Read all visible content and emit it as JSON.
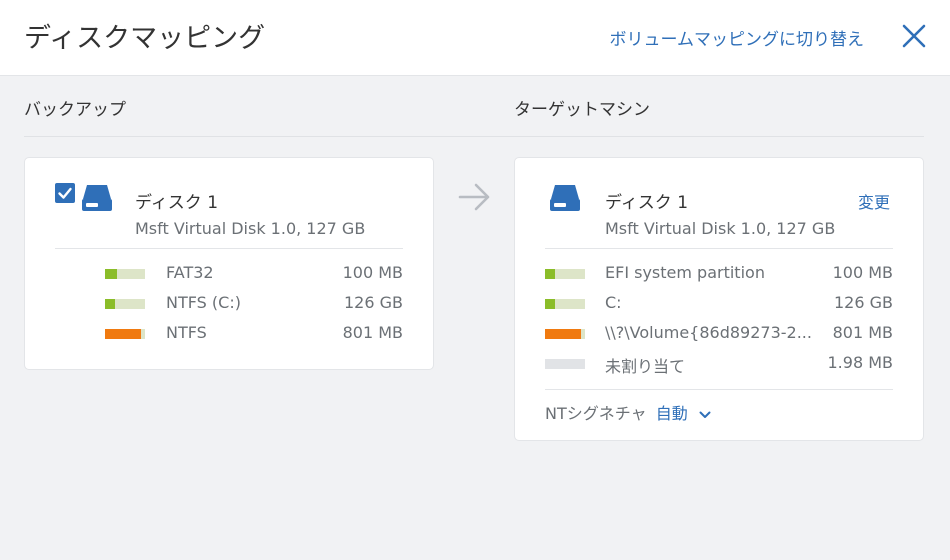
{
  "header": {
    "title": "ディスクマッピング",
    "switch_link": "ボリュームマッピングに切り替え",
    "close_icon": "close-icon"
  },
  "columns": {
    "backup_label": "バックアップ",
    "target_label": "ターゲットマシン"
  },
  "backup": {
    "checked": true,
    "disk_name": "ディスク 1",
    "disk_sub": "Msft Virtual Disk 1.0, 127 GB",
    "partitions": [
      {
        "name": "FAT32",
        "size": "100 MB",
        "fill": 0.3,
        "color": "#8bbd29"
      },
      {
        "name": "NTFS (C:)",
        "size": "126 GB",
        "fill": 0.25,
        "color": "#8bbd29"
      },
      {
        "name": "NTFS",
        "size": "801 MB",
        "fill": 0.9,
        "color": "#f07a10"
      }
    ]
  },
  "target": {
    "disk_name": "ディスク 1",
    "disk_sub": "Msft Virtual Disk 1.0, 127 GB",
    "change_link": "変更",
    "partitions": [
      {
        "name": "EFI system partition",
        "size": "100 MB",
        "fill": 0.25,
        "color": "#8bbd29"
      },
      {
        "name": "C:",
        "size": "126 GB",
        "fill": 0.25,
        "color": "#8bbd29"
      },
      {
        "name": "\\\\?\\Volume{86d89273-2...",
        "size": "801 MB",
        "fill": 0.9,
        "color": "#f07a10"
      },
      {
        "name": "未割り当て",
        "size": "1.98 MB",
        "fill": 0,
        "color": "#e1e3e6"
      }
    ],
    "nt_signature_label": "NTシグネチャ",
    "nt_signature_value": "自動"
  },
  "colors": {
    "accent": "#2f6fb8",
    "green": "#8bbd29",
    "orange": "#f07a10"
  }
}
